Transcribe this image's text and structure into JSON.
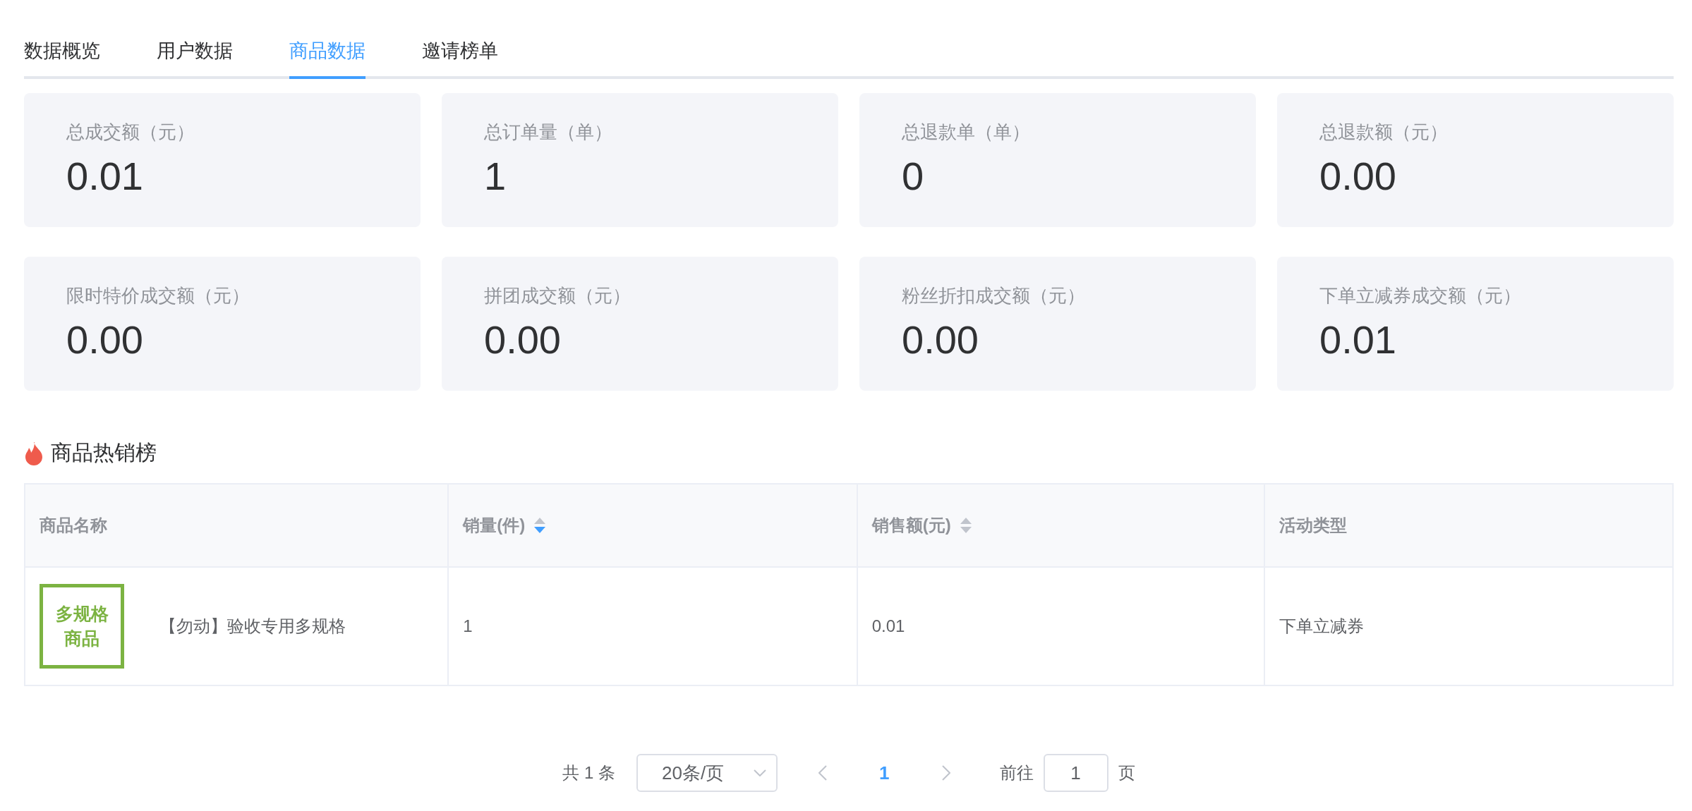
{
  "tabs": [
    {
      "label": "数据概览",
      "selected": false
    },
    {
      "label": "用户数据",
      "selected": false
    },
    {
      "label": "商品数据",
      "selected": true
    },
    {
      "label": "邀请榜单",
      "selected": false
    }
  ],
  "stats": [
    {
      "label": "总成交额（元）",
      "value": "0.01"
    },
    {
      "label": "总订单量（单）",
      "value": "1"
    },
    {
      "label": "总退款单（单）",
      "value": "0"
    },
    {
      "label": "总退款额（元）",
      "value": "0.00"
    },
    {
      "label": "限时特价成交额（元）",
      "value": "0.00"
    },
    {
      "label": "拼团成交额（元）",
      "value": "0.00"
    },
    {
      "label": "粉丝折扣成交额（元）",
      "value": "0.00"
    },
    {
      "label": "下单立减券成交额（元）",
      "value": "0.01"
    }
  ],
  "hot_list": {
    "title": "商品热销榜",
    "columns": [
      {
        "label": "商品名称"
      },
      {
        "label": "销量(件)",
        "sort_descending": true
      },
      {
        "label": "销售额(元)",
        "sort_descending": false
      },
      {
        "label": "活动类型"
      }
    ],
    "rows": [
      {
        "thumb_lines": [
          "多规格",
          "商品"
        ],
        "name": "【勿动】验收专用多规格",
        "sales": "1",
        "amount": "0.01",
        "activity": "下单立减券"
      }
    ]
  },
  "pagination": {
    "total": "共 1 条",
    "page_size": "20条/页",
    "pages": [
      {
        "label": "1",
        "selected": true
      }
    ],
    "goto_label": "前往",
    "goto_value": "1",
    "goto_suffix": "页"
  }
}
